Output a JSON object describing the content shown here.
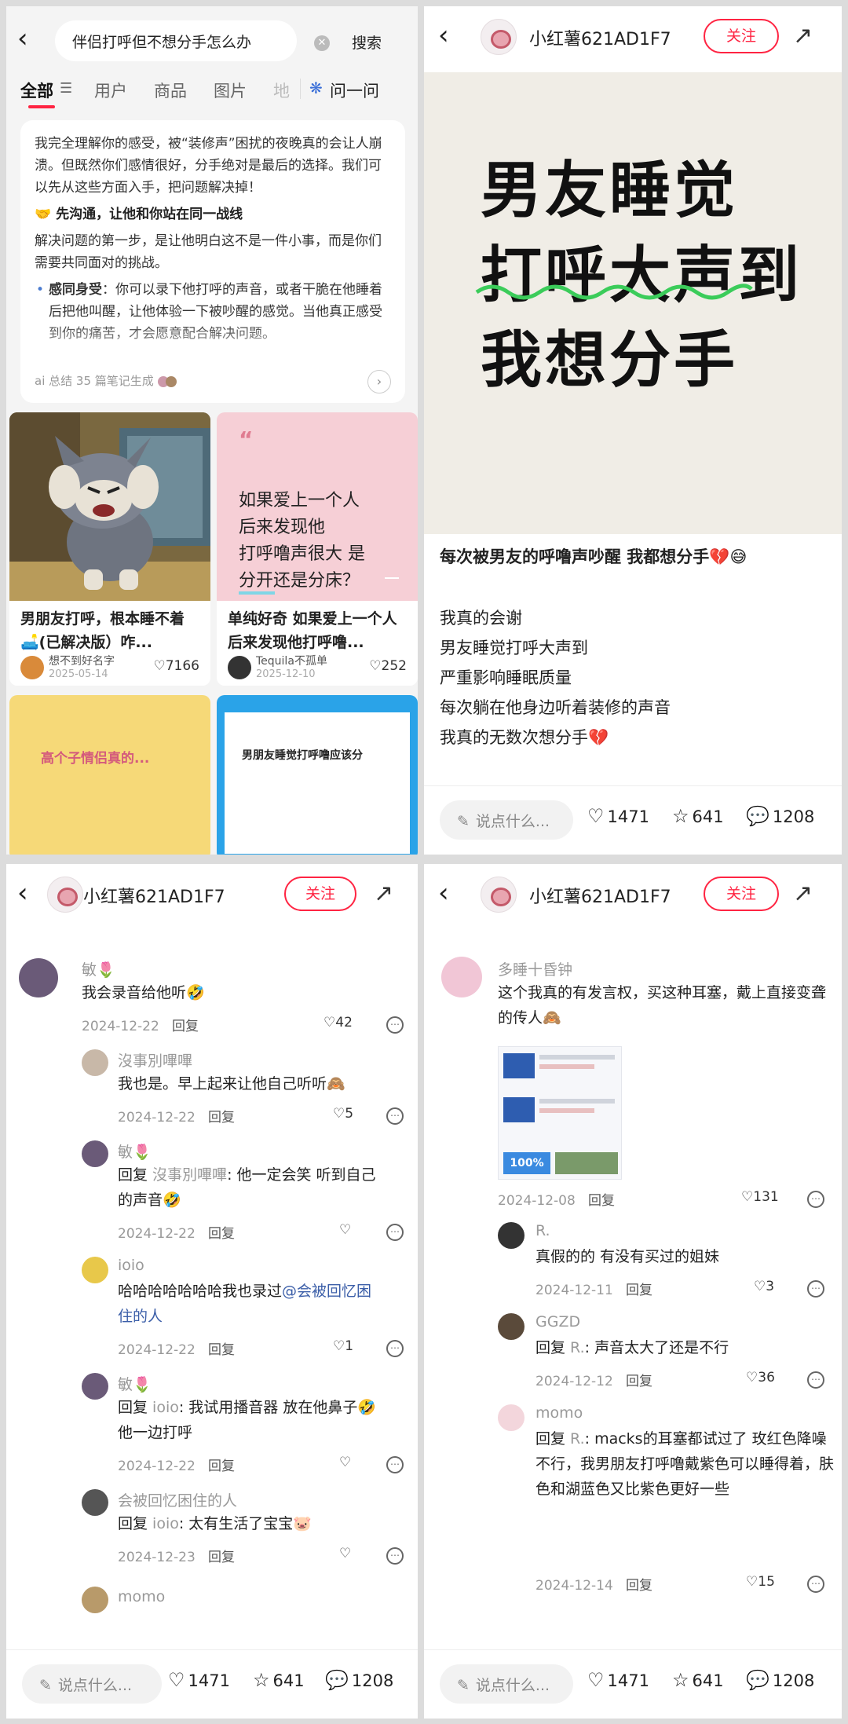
{
  "panel1": {
    "search_query": "伴侣打呼但不想分手怎么办",
    "search_button": "搜索",
    "tabs": [
      "全部",
      "用户",
      "商品",
      "图片",
      "地"
    ],
    "ask_tab": "问一问",
    "ai_summary": {
      "intro": "我完全理解你的感受，被“装修声”困扰的夜晚真的会让人崩溃。但既然你们感情很好，分手绝对是最后的选择。我们可以先从这些方面入手，把问题解决掉！",
      "heading": "🤝 先沟通，让他和你站在同一战线",
      "para": "解决问题的第一步，是让他明白这不是一件小事，而是你们需要共同面对的挑战。",
      "bullet_title": "感同身受",
      "bullet_text": "：你可以录下他打呼的声音，或者干脆在他睡着后把他叫醒，让他体验一下被吵醒的感觉。当他真正感受到你的痛苦，才会愿意配合解决问题。",
      "footer": "ai 总结 35 篇笔记生成"
    },
    "notes": [
      {
        "title": "男朋友打呼，根本睡不着🛋️(已解决版）咋...",
        "author": "想不到好名字",
        "date": "2025-05-14",
        "likes": "7166"
      },
      {
        "title": "单纯好奇 如果爱上一个人 后来发现他打呼噜...",
        "author": "Tequila不孤单",
        "date": "2025-12-10",
        "likes": "252",
        "cover_lines": [
          "如果爱上一个人",
          "后来发现他",
          "打呼噜声很大 是",
          "分开还是分床？"
        ]
      }
    ],
    "peek_text_left": "高个子情侣真的...",
    "peek_text_right": "男朋友睡觉打呼噜应该分"
  },
  "header": {
    "username": "小红薯621AD1F7",
    "follow": "关注"
  },
  "panel2": {
    "cover_lines": [
      "男友睡觉",
      "打呼大声到",
      "我想分手"
    ],
    "title": "每次被男友的呼噜声吵醒 我都想分手💔😅",
    "body": [
      "我真的会谢",
      "男友睡觉打呼大声到",
      "严重影响睡眠质量",
      "每次躺在他身边听着装修的声音",
      "我真的无数次想分手💔"
    ]
  },
  "bottom": {
    "say_placeholder": "说点什么...",
    "likes": "1471",
    "stars": "641",
    "comments": "1208"
  },
  "panel3": {
    "comments": [
      {
        "name": "敏🌷",
        "text": "我会录音给他听🤣",
        "date": "2024-12-22",
        "reply": "回复",
        "likes": "42"
      },
      {
        "name": "沒事別嗶嗶",
        "text": "我也是。早上起来让他自己听听🙈",
        "date": "2024-12-22",
        "reply": "回复",
        "likes": "5"
      },
      {
        "name": "敏🌷",
        "reply_prefix": "回复 ",
        "reply_to": "沒事別嗶嗶",
        "text": ": 他一定会笑 听到自己的声音🤣",
        "date": "2024-12-22",
        "reply": "回复",
        "likes": ""
      },
      {
        "name": "ioio",
        "text": "哈哈哈哈哈哈哈我也录过",
        "mention": "@会被回忆困住的人",
        "date": "2024-12-22",
        "reply": "回复",
        "likes": "1"
      },
      {
        "name": "敏🌷",
        "reply_prefix": "回复 ",
        "reply_to": "ioio",
        "text": ": 我试用播音器 放在他鼻子🤣 他一边打呼",
        "date": "2024-12-22",
        "reply": "回复",
        "likes": ""
      },
      {
        "name": "会被回忆困住的人",
        "reply_prefix": "回复 ",
        "reply_to": "ioio",
        "text": ": 太有生活了宝宝🐷",
        "date": "2024-12-23",
        "reply": "回复",
        "likes": ""
      },
      {
        "name": "momo"
      }
    ]
  },
  "panel4": {
    "comments": [
      {
        "name": "多睡十昏钟",
        "text": "这个我真的有发言权，买这种耳塞，戴上直接变聋的传人🙈",
        "date": "2024-12-08",
        "reply": "回复",
        "likes": "131"
      },
      {
        "name": "R.",
        "text": "真假的的 有没有买过的姐妹",
        "date": "2024-12-11",
        "reply": "回复",
        "likes": "3"
      },
      {
        "name": "GGZD",
        "reply_prefix": "回复 ",
        "reply_to": "R.",
        "text": ": 声音太大了还是不行",
        "date": "2024-12-12",
        "reply": "回复",
        "likes": "36"
      },
      {
        "name": "momo",
        "reply_prefix": "回复 ",
        "reply_to": "R.",
        "text": ": macks的耳塞都试过了 玫红色降噪不行，我男朋友打呼噜戴紫色可以睡得着，肤色和湖蓝色又比紫色更好一些",
        "date": "2024-12-14",
        "reply": "回复",
        "likes": "15"
      }
    ],
    "product_badge": "100%"
  }
}
